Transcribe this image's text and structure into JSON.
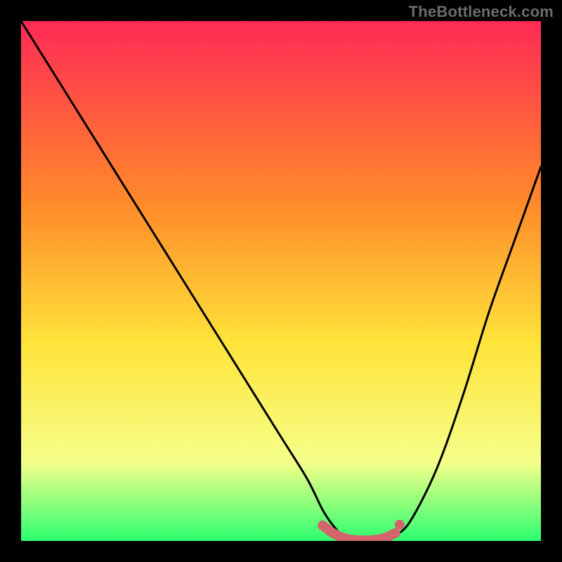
{
  "watermark": "TheBottleneck.com",
  "colors": {
    "frame": "#000000",
    "gradient_top": "#ff2a55",
    "gradient_mid1": "#ff8a2a",
    "gradient_mid2": "#ffe43a",
    "gradient_mid3": "#f5ff8a",
    "gradient_bottom": "#2dff70",
    "curve": "#000000",
    "marker_stroke": "#c9565f",
    "marker_fill": "#d4646c"
  },
  "chart_data": {
    "type": "line",
    "title": "",
    "xlabel": "",
    "ylabel": "",
    "xlim": [
      0,
      100
    ],
    "ylim": [
      0,
      100
    ],
    "series": [
      {
        "name": "bottleneck-curve",
        "x": [
          0,
          5,
          10,
          15,
          20,
          25,
          30,
          35,
          40,
          45,
          50,
          55,
          58,
          60,
          62,
          65,
          68,
          70,
          72,
          75,
          80,
          85,
          90,
          95,
          100
        ],
        "y": [
          100,
          92,
          84,
          76,
          68,
          60,
          52,
          44,
          36,
          28,
          20,
          12,
          6,
          3,
          1,
          0,
          0,
          0,
          1,
          4,
          14,
          28,
          44,
          58,
          72
        ]
      }
    ],
    "markers": {
      "name": "optimal-range",
      "x": [
        58,
        60,
        62,
        64,
        66,
        68,
        70,
        72
      ],
      "y": [
        3,
        1.5,
        0.6,
        0.2,
        0.1,
        0.2,
        0.6,
        1.5
      ]
    }
  }
}
